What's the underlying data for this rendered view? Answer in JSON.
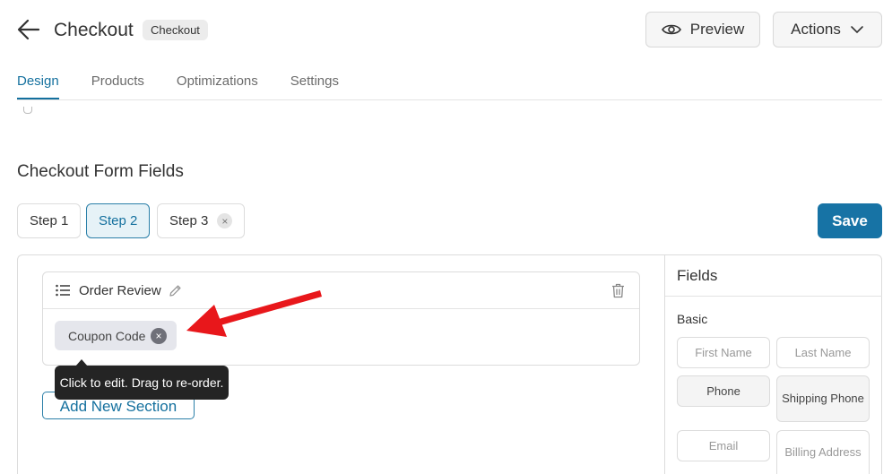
{
  "header": {
    "title": "Checkout",
    "badge": "Checkout",
    "preview_label": "Preview",
    "actions_label": "Actions"
  },
  "tabs": [
    {
      "label": "Design",
      "active": true
    },
    {
      "label": "Products",
      "active": false
    },
    {
      "label": "Optimizations",
      "active": false
    },
    {
      "label": "Settings",
      "active": false
    }
  ],
  "section_title": "Checkout Form Fields",
  "steps": [
    {
      "label": "Step 1",
      "active": false
    },
    {
      "label": "Step 2",
      "active": true
    },
    {
      "label": "Step 3",
      "active": false,
      "remove_glyph": "×"
    }
  ],
  "save_label": "Save",
  "editor": {
    "section_name": "Order Review",
    "coupon_field": "Coupon Code",
    "chip_remove_glyph": "×",
    "tooltip": "Click to edit. Drag to re-order.",
    "add_section_label": "Add New Section"
  },
  "fields_panel": {
    "title": "Fields",
    "group_label": "Basic",
    "items": [
      {
        "label": "First Name"
      },
      {
        "label": "Last Name"
      },
      {
        "label": "Phone"
      },
      {
        "label": "Shipping Phone"
      },
      {
        "label": "Email"
      },
      {
        "label": "Billing Address"
      }
    ]
  },
  "colors": {
    "accent": "#14709e",
    "save_bg": "#1773a5",
    "tooltip_bg": "#242424",
    "arrow_red": "#e8171b"
  }
}
